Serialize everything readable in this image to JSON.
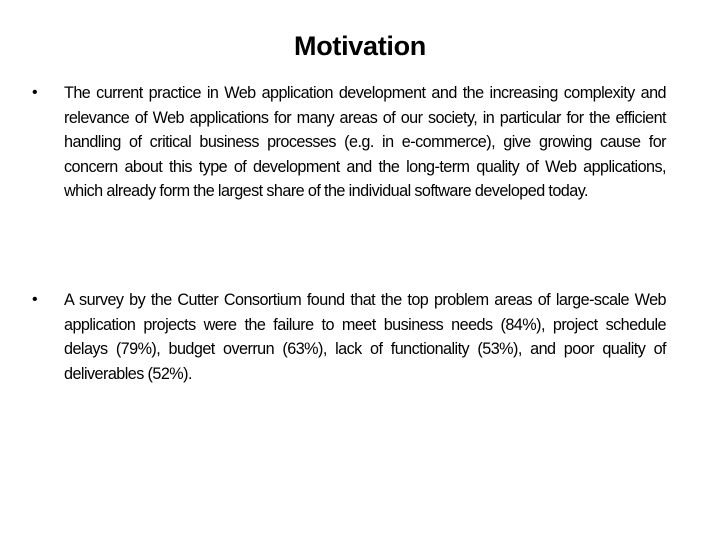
{
  "slide": {
    "title": "Motivation",
    "bullets": [
      {
        "marker": "•",
        "text": "The current practice in Web application development and the increasing complexity and relevance of Web applications for many areas of our society, in particular for the efficient handling of critical business processes (e.g. in e-commerce), give growing cause for concern about this type of development and the long-term quality of Web applications, which already form the largest share of the individual software developed today."
      },
      {
        "marker": "•",
        "text": "A survey by the Cutter Consortium found that the top problem areas of large-scale Web application projects were the failure to meet business needs (84%), project schedule delays (79%), budget overrun (63%), lack of functionality (53%), and poor quality of deliverables (52%)."
      }
    ]
  }
}
